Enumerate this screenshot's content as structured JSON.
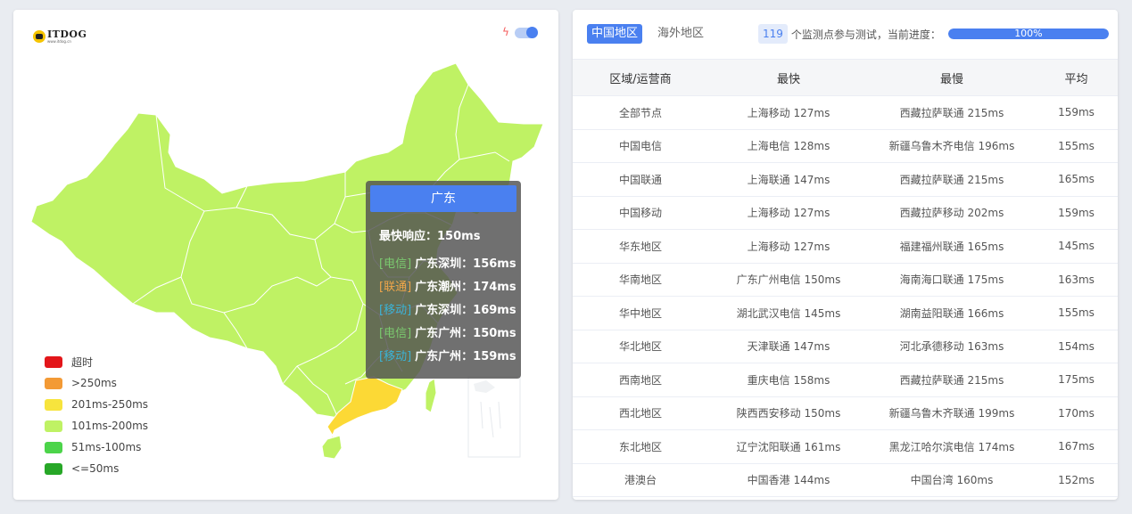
{
  "map_panel": {
    "logo": {
      "name": "ITDOG",
      "sub": "www.itdog.cn"
    },
    "tooltip": {
      "title": "广东",
      "best_label": "最快响应：",
      "best_value": "150ms",
      "rows": [
        {
          "tag": "[电信]",
          "tag_color": "#7bc96f",
          "text": "广东深圳：156ms"
        },
        {
          "tag": "[联通]",
          "tag_color": "#f0a64a",
          "text": "广东潮州：174ms"
        },
        {
          "tag": "[移动]",
          "tag_color": "#3bb3d6",
          "text": "广东深圳：169ms"
        },
        {
          "tag": "[电信]",
          "tag_color": "#7bc96f",
          "text": "广东广州：150ms"
        },
        {
          "tag": "[移动]",
          "tag_color": "#3bb3d6",
          "text": "广东广州：159ms"
        }
      ]
    },
    "legend": [
      {
        "label": "超时",
        "color": "#e3161a"
      },
      {
        "label": ">250ms",
        "color": "#f39a35"
      },
      {
        "label": "201ms-250ms",
        "color": "#f7e43d"
      },
      {
        "label": "101ms-200ms",
        "color": "#bff264"
      },
      {
        "label": "51ms-100ms",
        "color": "#4cd44a"
      },
      {
        "label": "<=50ms",
        "color": "#27a727"
      }
    ],
    "colors": {
      "province": "#bff264",
      "highlight": "#fcd935",
      "inactive": "#f0f2f4"
    }
  },
  "results_panel": {
    "tabs": [
      {
        "label": "中国地区",
        "active": true
      },
      {
        "label": "海外地区",
        "active": false
      }
    ],
    "node_count": "119",
    "progress_text": "个监测点参与测试，当前进度：",
    "progress_percent": 100,
    "progress_label": "100%",
    "table": {
      "headers": [
        "区域/运营商",
        "最快",
        "最慢",
        "平均"
      ],
      "rows": [
        [
          "全部节点",
          "上海移动 127ms",
          "西藏拉萨联通 215ms",
          "159ms"
        ],
        [
          "中国电信",
          "上海电信 128ms",
          "新疆乌鲁木齐电信 196ms",
          "155ms"
        ],
        [
          "中国联通",
          "上海联通 147ms",
          "西藏拉萨联通 215ms",
          "165ms"
        ],
        [
          "中国移动",
          "上海移动 127ms",
          "西藏拉萨移动 202ms",
          "159ms"
        ],
        [
          "华东地区",
          "上海移动 127ms",
          "福建福州联通 165ms",
          "145ms"
        ],
        [
          "华南地区",
          "广东广州电信 150ms",
          "海南海口联通 175ms",
          "163ms"
        ],
        [
          "华中地区",
          "湖北武汉电信 145ms",
          "湖南益阳联通 166ms",
          "155ms"
        ],
        [
          "华北地区",
          "天津联通 147ms",
          "河北承德移动 163ms",
          "154ms"
        ],
        [
          "西南地区",
          "重庆电信 158ms",
          "西藏拉萨联通 215ms",
          "175ms"
        ],
        [
          "西北地区",
          "陕西西安移动 150ms",
          "新疆乌鲁木齐联通 199ms",
          "170ms"
        ],
        [
          "东北地区",
          "辽宁沈阳联通 161ms",
          "黑龙江哈尔滨电信 174ms",
          "167ms"
        ],
        [
          "港澳台",
          "中国香港 144ms",
          "中国台湾 160ms",
          "152ms"
        ]
      ]
    }
  }
}
